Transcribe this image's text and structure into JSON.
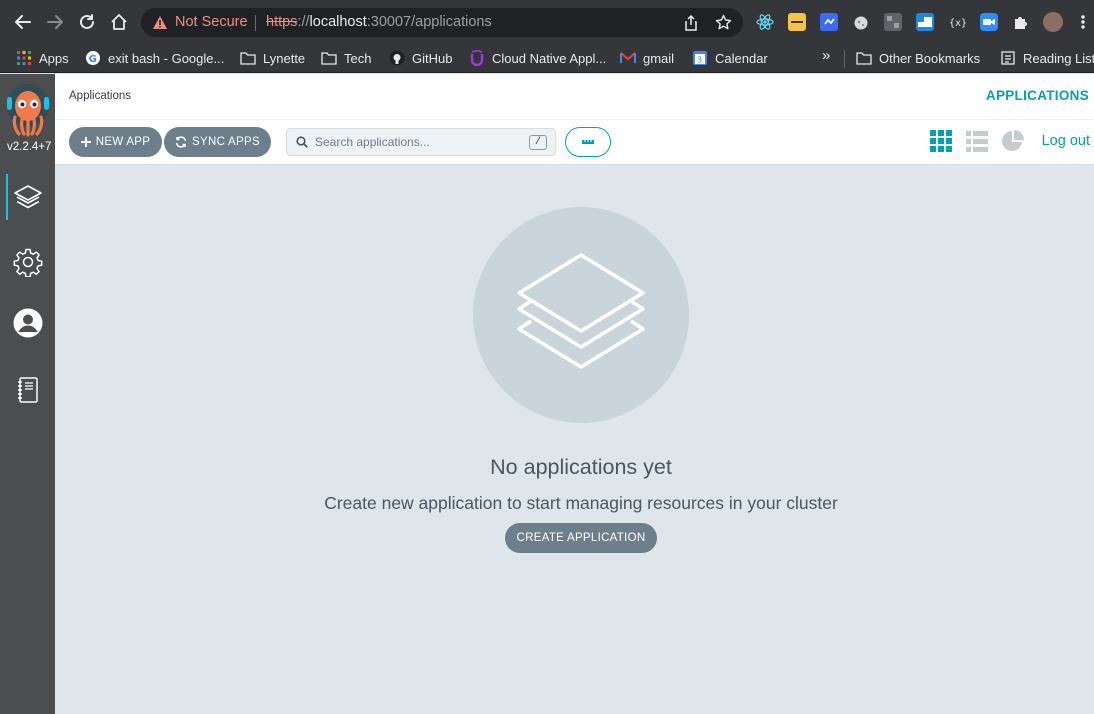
{
  "browser": {
    "security_label": "Not Secure",
    "url_scheme": "https",
    "url_sep": "://",
    "url_host": "localhost",
    "url_rest": ":30007/applications",
    "bookmarks": [
      {
        "label": "Apps",
        "icon": "apps-grid-icon"
      },
      {
        "label": "exit bash - Google...",
        "icon": "google-icon"
      },
      {
        "label": "Lynette",
        "icon": "folder-icon"
      },
      {
        "label": "Tech",
        "icon": "folder-icon"
      },
      {
        "label": "GitHub",
        "icon": "github-icon"
      },
      {
        "label": "Cloud Native Appl...",
        "icon": "udemy-icon"
      },
      {
        "label": "gmail",
        "icon": "gmail-icon"
      },
      {
        "label": "Calendar",
        "icon": "calendar-icon"
      }
    ],
    "more_bookmarks": "»",
    "other_bookmarks": "Other Bookmarks",
    "reading_list": "Reading List"
  },
  "sidebar": {
    "version": "v2.2.4+7",
    "items": [
      {
        "name": "applications",
        "icon": "layers-icon",
        "active": true
      },
      {
        "name": "settings",
        "icon": "gear-icon",
        "active": false
      },
      {
        "name": "user-info",
        "icon": "user-icon",
        "active": false
      },
      {
        "name": "documentation",
        "icon": "book-icon",
        "active": false
      }
    ]
  },
  "header": {
    "page_title": "Applications",
    "apps_link": "APPLICATIONS"
  },
  "toolbar": {
    "new_app": "NEW APP",
    "sync_apps": "SYNC APPS",
    "search_placeholder": "Search applications...",
    "search_shortcut": "/",
    "logout": "Log out"
  },
  "empty_state": {
    "title": "No applications yet",
    "subtitle": "Create new application to start managing resources in your cluster",
    "button": "CREATE APPLICATION"
  },
  "colors": {
    "accent": "#00a2b3",
    "sidebar": "#4c4d4f",
    "button": "#6d7f8b",
    "background": "#dee6eb"
  }
}
